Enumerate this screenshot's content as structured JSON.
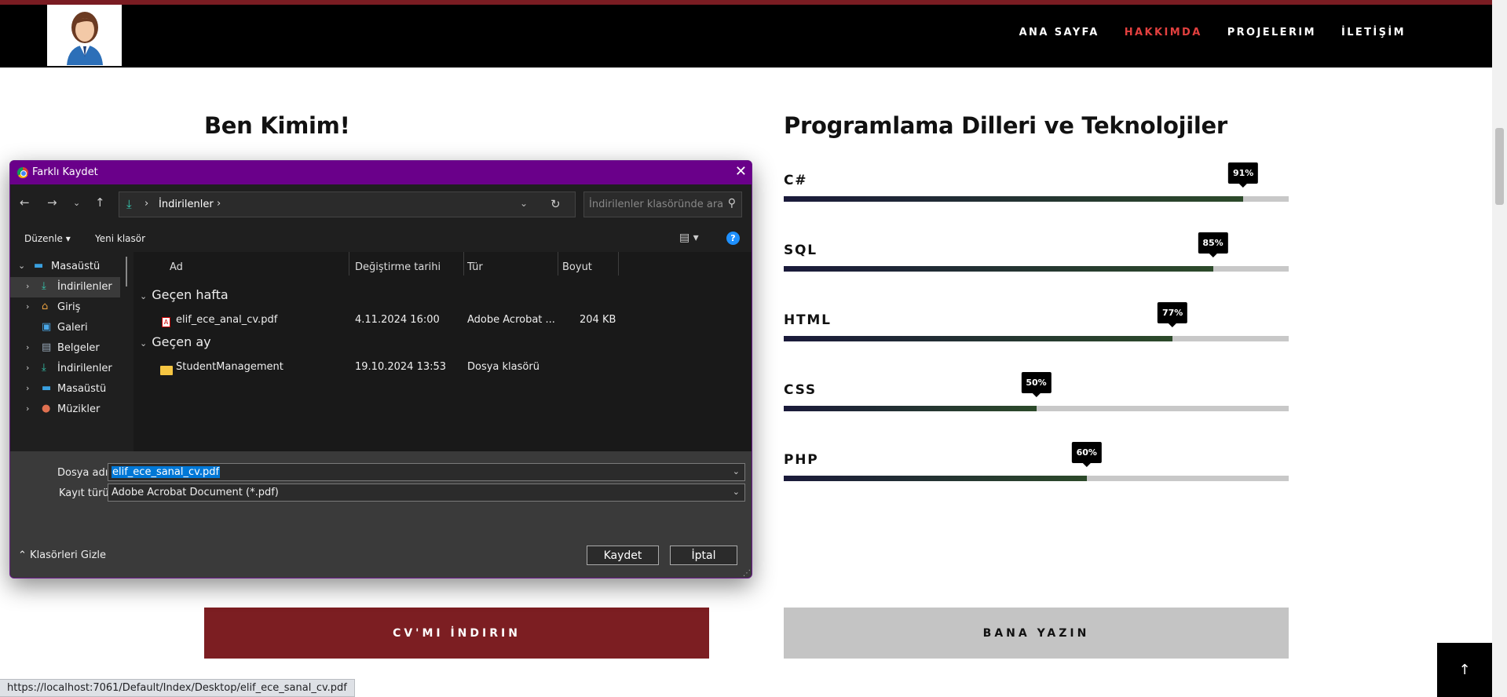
{
  "nav": {
    "items": [
      "ANA SAYFA",
      "HAKKIMDA",
      "PROJELERIM",
      "İLETİŞİM"
    ],
    "active": "HAKKIMDA"
  },
  "sections": {
    "about_title": "Ben Kimim!",
    "skills_title": "Programlama Dilleri ve Teknolojiler"
  },
  "skills": [
    {
      "name": "C#",
      "percent": 91,
      "label": "91%"
    },
    {
      "name": "SQL",
      "percent": 85,
      "label": "85%"
    },
    {
      "name": "HTML",
      "percent": 77,
      "label": "77%"
    },
    {
      "name": "CSS",
      "percent": 50,
      "label": "50%"
    },
    {
      "name": "PHP",
      "percent": 60,
      "label": "60%"
    }
  ],
  "buttons": {
    "cv": "CV'MI İNDIRIN",
    "write": "BANA YAZIN",
    "to_top": "↑"
  },
  "status_url": "https://localhost:7061/Default/Index/Desktop/elif_ece_sanal_cv.pdf",
  "dialog": {
    "title": "Farklı Kaydet",
    "path": "İndirilenler",
    "search_placeholder": "İndirilenler klasöründe ara",
    "organize": "Düzenle",
    "new_folder": "Yeni klasör",
    "tree": [
      "Masaüstü",
      "İndirilenler",
      "Giriş",
      "Galeri",
      "Belgeler",
      "İndirilenler",
      "Masaüstü",
      "Müzikler"
    ],
    "columns": {
      "name": "Ad",
      "modified": "Değiştirme tarihi",
      "type": "Tür",
      "size": "Boyut"
    },
    "groups": [
      {
        "label": "Geçen hafta",
        "files": [
          {
            "name": "elif_ece_anal_cv.pdf",
            "modified": "4.11.2024 16:00",
            "type": "Adobe Acrobat ...",
            "size": "204 KB"
          }
        ]
      },
      {
        "label": "Geçen ay",
        "files": [
          {
            "name": "StudentManagement",
            "modified": "19.10.2024 13:53",
            "type": "Dosya klasörü",
            "size": ""
          }
        ]
      }
    ],
    "filename_label": "Dosya adı:",
    "filename_value": "elif_ece_sanal_cv.pdf",
    "filetype_label": "Kayıt türü:",
    "filetype_value": "Adobe Acrobat Document (*.pdf)",
    "hide_folders": "Klasörleri Gizle",
    "save": "Kaydet",
    "cancel": "İptal"
  }
}
